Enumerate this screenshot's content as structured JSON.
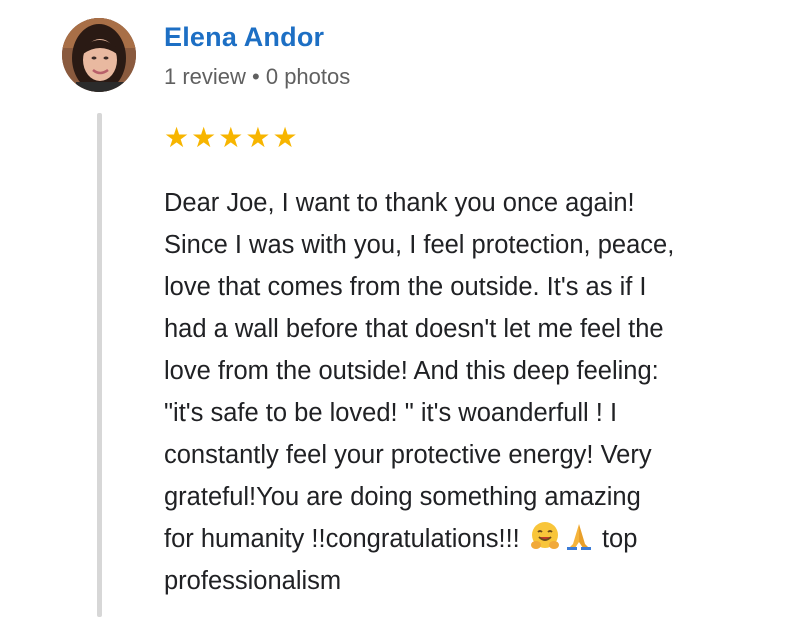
{
  "reviewer": {
    "name": "Elena Andor",
    "meta": "1 review • 0 photos"
  },
  "rating": {
    "stars": 5,
    "max": 5,
    "star_color": "#f7b500"
  },
  "review": {
    "lines": [
      "Dear Joe, I want to thank you once again!",
      "Since I was with you, I feel protection, peace,",
      "love that comes from the outside. It's as if I",
      "had a wall before that doesn't let me feel the",
      "love from the outside! And this deep feeling:",
      "\"it's safe to be loved! \" it's woanderfull ! I",
      "constantly feel your protective energy! Very",
      "grateful!You are doing something amazing",
      "for humanity !!congratulations!!! ",
      "professionalism"
    ],
    "after_emoji": " top",
    "emoji_icons": [
      "hugging-face-icon",
      "folded-hands-icon"
    ]
  },
  "colors": {
    "name": "#1d6fc4",
    "meta": "#606060",
    "text": "#202124",
    "thread_line": "#d7d7d7"
  }
}
